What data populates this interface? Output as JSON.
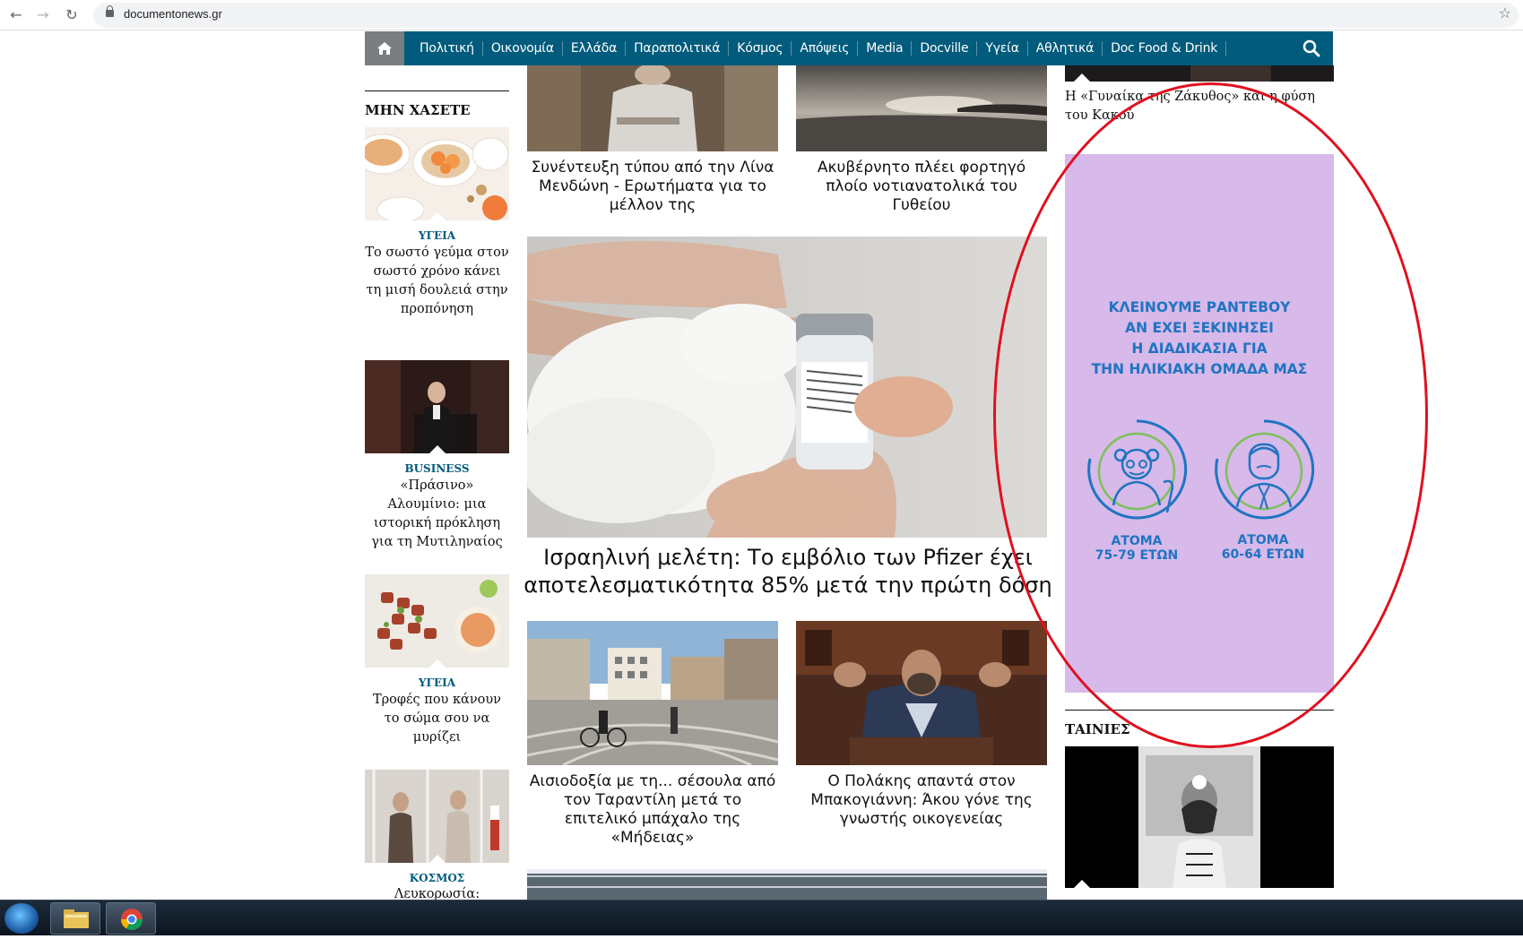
{
  "browser": {
    "url": "documentonews.gr"
  },
  "nav": {
    "items": [
      "Πολιτική",
      "Οικονομία",
      "Ελλάδα",
      "Παραπολιτικά",
      "Κόσμος",
      "Απόψεις",
      "Media",
      "Docville",
      "Υγεία",
      "Αθλητικά",
      "Doc Food & Drink"
    ]
  },
  "left": {
    "section_title": "ΜΗΝ ΧΑΣΕΤΕ",
    "items": [
      {
        "category": "ΥΓΕΙΑ",
        "title": "Το σωστό γεύμα στον σωστό χρόνο κάνει τη μισή δουλειά στην προπόνηση"
      },
      {
        "category": "BUSINESS",
        "title": "«Πράσινο» Αλουμίνιο: μια ιστορική πρόκληση για τη Μυτιληναίος"
      },
      {
        "category": "ΥΓΕΙΑ",
        "title": "Τροφές που κάνουν το σώμα σου να μυρίζει"
      },
      {
        "category": "ΚΟΣΜΟΣ",
        "title": "Λευκορωσία:"
      }
    ]
  },
  "center": {
    "top_left_title": "Συνέντευξη τύπου από την Λίνα Μενδώνη - Ερωτήματα για το μέλλον της",
    "top_right_title": "Ακυβέρνητο πλέει φορτηγό πλοίο νοτιανατολικά του Γυθείου",
    "main_title": "Ισραηλινή μελέτη: Το εμβόλιο των Pfizer έχει αποτελεσματικότητα 85% μετά την πρώτη δόση",
    "bottom_left_title": "Αισιοδοξία με τη... σέσουλα από τον Ταραντίλη μετά το επιτελικό μπάχαλο της «Μήδειας»",
    "bottom_right_title": "Ο Πολάκης απαντά στον Μπακογιάννη: Άκου γόνε της γνωστής οικογενείας"
  },
  "right": {
    "top_title": "Η «Γυναίκα της Ζάκυθος» και η φύση του Κακού",
    "ad": {
      "heading_lines": [
        "ΚΛΕΙΝΟΥΜΕ ΡΑΝΤΕΒΟΥ",
        "ΑΝ ΕΧΕΙ ΞΕΚΙΝΗΣΕΙ",
        "Η ΔΙΑΔΙΚΑΣΙΑ ΓΙΑ",
        "ΤΗΝ ΗΛΙΚΙΑΚΗ ΟΜΑΔΑ ΜΑΣ"
      ],
      "group1_label": "ΑΤΟΜΑ",
      "group1_range": "75-79 ΕΤΩΝ",
      "group2_label": "ΑΤΟΜΑ",
      "group2_range": "60-64 ΕΤΩΝ",
      "text_color": "#1f74c2",
      "bg_color": "#d7b9ea"
    },
    "section_title": "ΤΑΙΝΙΕΣ"
  },
  "annotation_color": "#e0101f"
}
